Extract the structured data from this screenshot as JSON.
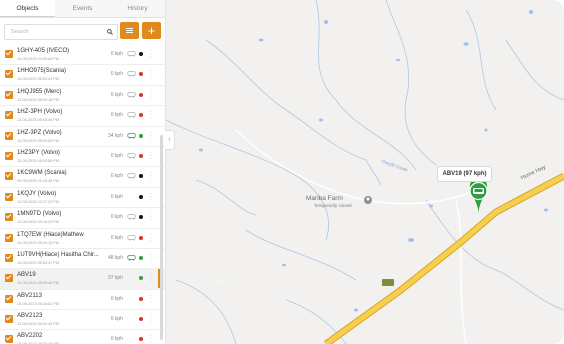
{
  "tabs": [
    {
      "label": "Objects",
      "active": true
    },
    {
      "label": "Events",
      "active": false
    },
    {
      "label": "History",
      "active": false
    }
  ],
  "search": {
    "placeholder": "Search"
  },
  "toolbar": {
    "add_label": "+"
  },
  "objects": [
    {
      "name": "1GHY-405 (IVECO)",
      "date": "13-08-2023 04:52:08 PM",
      "speed": "0 kph",
      "status": "black",
      "car": "outline"
    },
    {
      "name": "1HHO975(Scania)",
      "date": "13-08-2023 08:53:43 PM",
      "speed": "0 kph",
      "status": "red",
      "car": "outline"
    },
    {
      "name": "1HQJ955 (Merc)",
      "date": "13-08-2023 08:53:16 PM",
      "speed": "0 kph",
      "status": "red",
      "car": "outline"
    },
    {
      "name": "1HZ-3PH (Volvo)",
      "date": "13-08-2023 08:53:46 PM",
      "speed": "0 kph",
      "status": "red",
      "car": "outline"
    },
    {
      "name": "1HZ-3PZ (Volvo)",
      "date": "13-08-2023 08:53:08 PM",
      "speed": "34 kph",
      "status": "green",
      "car": "green"
    },
    {
      "name": "1HZ3PY (Volvo)",
      "date": "13-08-2023 08:53:56 PM",
      "speed": "0 kph",
      "status": "red",
      "car": "outline"
    },
    {
      "name": "1KC9WM (Scania)",
      "date": "09-08-2023 01:25:48 PM",
      "speed": "0 kph",
      "status": "black",
      "car": "outline"
    },
    {
      "name": "1KQJY (Volvo)",
      "date": "13-08-2023 02:27:22 PM",
      "speed": "0 kph",
      "status": "black",
      "car": "none"
    },
    {
      "name": "1MN9TD (Volvo)",
      "date": "13-08-2023 05:16:29 PM",
      "speed": "0 kph",
      "status": "black",
      "car": "outline"
    },
    {
      "name": "1TQ7EW (Hiace)Mathew",
      "date": "13-08-2023 08:54:15 PM",
      "speed": "0 kph",
      "status": "red",
      "car": "outline"
    },
    {
      "name": "1UT9VH(Hiace) Hasitha Chir...",
      "date": "13-08-2023 08:53:47 PM",
      "speed": "48 kph",
      "status": "green",
      "car": "green"
    },
    {
      "name": "ABV19",
      "date": "13-08-2023 08:53:46 PM",
      "speed": "97 kph",
      "status": "green",
      "car": "none",
      "selected": true
    },
    {
      "name": "ABV2113",
      "date": "13-08-2023 08:44:52 PM",
      "speed": "0 kph",
      "status": "red",
      "car": "none"
    },
    {
      "name": "ABV2123",
      "date": "13-08-2023 08:51:35 PM",
      "speed": "0 kph",
      "status": "red",
      "car": "none"
    },
    {
      "name": "ABV2202",
      "date": "13-08-2023 08:53:45 PM",
      "speed": "0 kph",
      "status": "red",
      "car": "none"
    }
  ],
  "map": {
    "place_name": "Mariba Farm",
    "place_status": "Temporarily closed",
    "creek_label": "Gwydir Creek",
    "highway_label": "Hume Hwy",
    "road_shield": "M31",
    "vehicle_callout": "ABV19 (97 kph)"
  },
  "colors": {
    "accent": "#e08a1e",
    "green": "#2e9e3e",
    "red": "#e0302a",
    "road": "#f2c23a"
  }
}
